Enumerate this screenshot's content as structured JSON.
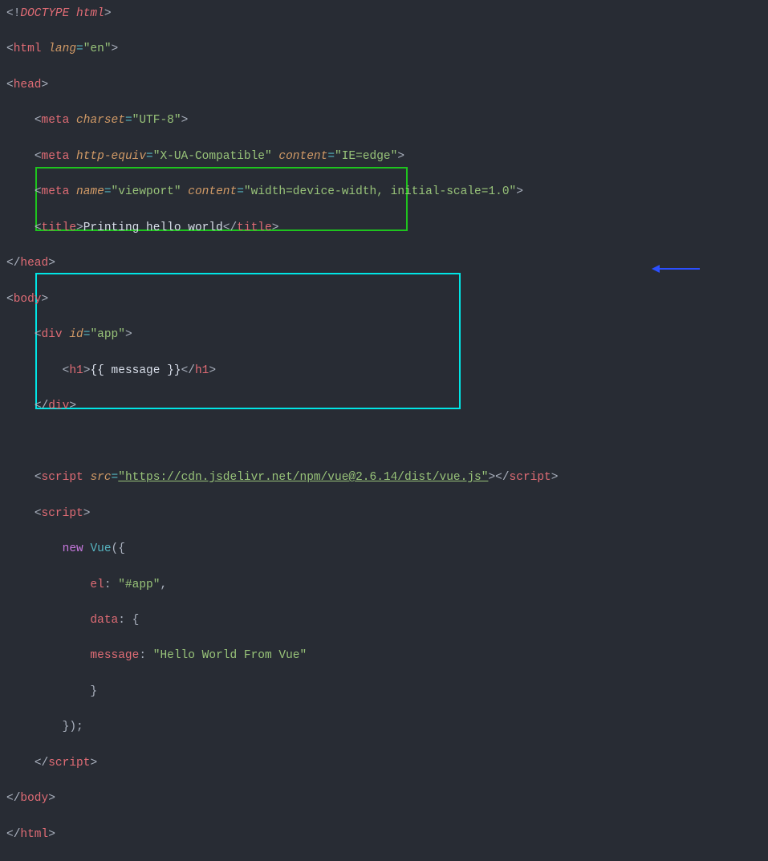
{
  "code": {
    "l1_doctype": "DOCTYPE html",
    "l2_tag": "html",
    "l2_attr": "lang",
    "l2_val": "\"en\"",
    "l3_tag": "head",
    "l4_tag": "meta",
    "l4_attr": "charset",
    "l4_val": "\"UTF-8\"",
    "l5_tag": "meta",
    "l5_attr": "http-equiv",
    "l5_val": "\"X-UA-Compatible\"",
    "l5_attr2": "content",
    "l5_val2": "\"IE=edge\"",
    "l6_tag": "meta",
    "l6_attr": "name",
    "l6_val": "\"viewport\"",
    "l6_attr2": "content",
    "l6_val2": "\"width=device-width, initial-scale=1.0\"",
    "l7_open": "title",
    "l7_text": "Printing hello world",
    "l7_close": "title",
    "l8_tag": "head",
    "l9_tag": "body",
    "l10_tag": "div",
    "l10_attr": "id",
    "l10_val": "\"app\"",
    "l11_open": "h1",
    "l11_text": "{{ message }}",
    "l11_close": "h1",
    "l12_tag": "div",
    "l14_tag": "script",
    "l14_attr": "src",
    "l14_val": "\"https://cdn.jsdelivr.net/npm/vue@2.6.14/dist/vue.js\"",
    "l14_close": "script",
    "l15_tag": "script",
    "l16_kw": "new",
    "l16_fn": "Vue",
    "l17_key": "el",
    "l17_val": "\"#app\"",
    "l18_key": "data",
    "l19_key": "message",
    "l19_val": "\"Hello World From Vue\"",
    "l22_tag": "script",
    "l23_tag": "body",
    "l24_tag": "html"
  }
}
